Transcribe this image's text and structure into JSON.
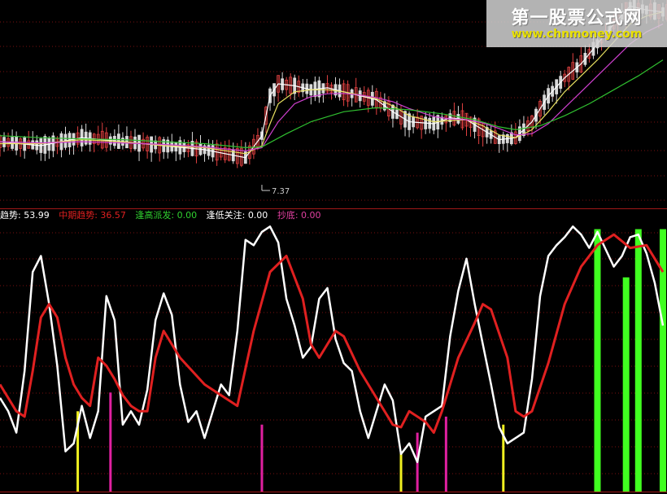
{
  "colors": {
    "background": "#000000",
    "grid": "#7a1010",
    "divider": "#a01818",
    "candle_up": "#e04040",
    "candle_down": "#d8d8d8",
    "ma_white": "#ffffff",
    "ma_yellow": "#e8e060",
    "ma_magenta": "#d040d0",
    "ma_green": "#30c030",
    "short_trend": "#ffffff",
    "mid_trend": "#e02020",
    "signal_yellow": "#f0f020",
    "signal_magenta": "#e020a0",
    "signal_green": "#40ff20"
  },
  "price_panel": {
    "low_marker_label": "7.37"
  },
  "indicator_bar": [
    {
      "label": "趋势",
      "value": "53.99",
      "color": "#ffffff"
    },
    {
      "label": "中期趋势",
      "value": "36.57",
      "color": "#e02020"
    },
    {
      "label": "逢高派发",
      "value": "0.00",
      "color": "#30d030"
    },
    {
      "label": "逢低关注",
      "value": "0.00",
      "color": "#ffffff"
    },
    {
      "label": "抄底",
      "value": "0.00",
      "color": "#e040a0"
    }
  ],
  "watermark": {
    "title": "第一股票公式网",
    "url": "www.chnmoney.com"
  },
  "chart_data": [
    {
      "type": "line",
      "panel": "price",
      "x_range": [
        0,
        163
      ],
      "y_range": [
        6.8,
        12.0
      ],
      "series": [
        {
          "color": "#ffffff",
          "x": [
            0,
            10,
            20,
            30,
            40,
            50,
            60,
            64,
            66,
            68,
            72,
            76,
            80,
            84,
            88,
            92,
            96,
            100,
            106,
            110,
            114,
            118,
            122,
            126,
            130,
            134,
            138,
            142,
            146,
            150,
            154,
            158,
            162
          ],
          "y": [
            8.45,
            8.35,
            8.55,
            8.45,
            8.35,
            8.25,
            8.05,
            8.6,
            9.6,
            9.9,
            9.85,
            9.75,
            9.8,
            9.7,
            9.6,
            9.5,
            9.2,
            8.95,
            8.9,
            9.05,
            9.0,
            8.75,
            8.5,
            8.55,
            8.95,
            9.6,
            10.05,
            10.4,
            10.9,
            11.4,
            11.85,
            11.75,
            11.7
          ]
        },
        {
          "color": "#e8e060",
          "x": [
            0,
            10,
            20,
            30,
            40,
            50,
            60,
            64,
            66,
            68,
            72,
            76,
            80,
            84,
            88,
            92,
            96,
            100,
            106,
            110,
            114,
            118,
            122,
            126,
            130,
            134,
            138,
            142,
            146,
            150,
            154,
            158,
            162
          ],
          "y": [
            8.4,
            8.4,
            8.5,
            8.45,
            8.35,
            8.3,
            8.15,
            8.35,
            8.9,
            9.4,
            9.7,
            9.75,
            9.75,
            9.7,
            9.62,
            9.52,
            9.35,
            9.1,
            8.95,
            8.98,
            9.0,
            8.85,
            8.62,
            8.55,
            8.75,
            9.2,
            9.7,
            10.1,
            10.5,
            10.95,
            11.4,
            11.6,
            11.7
          ]
        },
        {
          "color": "#d040d0",
          "x": [
            0,
            10,
            20,
            30,
            40,
            50,
            60,
            64,
            68,
            72,
            76,
            80,
            84,
            88,
            92,
            96,
            100,
            106,
            110,
            114,
            118,
            122,
            126,
            130,
            134,
            138,
            142,
            146,
            150,
            154,
            158,
            162
          ],
          "y": [
            8.45,
            8.42,
            8.45,
            8.42,
            8.38,
            8.32,
            8.22,
            8.3,
            8.95,
            9.4,
            9.58,
            9.65,
            9.66,
            9.62,
            9.55,
            9.45,
            9.28,
            9.08,
            9.02,
            9.0,
            8.92,
            8.78,
            8.62,
            8.65,
            8.9,
            9.3,
            9.7,
            10.1,
            10.5,
            10.9,
            11.2,
            11.4
          ]
        },
        {
          "color": "#30c030",
          "x": [
            0,
            10,
            20,
            30,
            40,
            50,
            60,
            64,
            70,
            76,
            84,
            92,
            100,
            108,
            116,
            122,
            126,
            132,
            138,
            144,
            150,
            156,
            162
          ],
          "y": [
            8.6,
            8.55,
            8.52,
            8.5,
            8.45,
            8.4,
            8.3,
            8.32,
            8.65,
            8.95,
            9.2,
            9.3,
            9.25,
            9.15,
            9.0,
            8.82,
            8.75,
            8.85,
            9.1,
            9.4,
            9.75,
            10.1,
            10.5
          ]
        }
      ],
      "low_marker": {
        "x": 64,
        "y": 7.37
      }
    },
    {
      "type": "line",
      "panel": "indicator",
      "x_range": [
        0,
        163
      ],
      "y_range": [
        0,
        100
      ],
      "series": [
        {
          "name": "趋势",
          "color": "#ffffff",
          "x": [
            0,
            2,
            4,
            6,
            8,
            10,
            12,
            14,
            16,
            18,
            20,
            22,
            24,
            26,
            28,
            30,
            32,
            34,
            36,
            38,
            40,
            42,
            44,
            46,
            48,
            50,
            52,
            54,
            56,
            58,
            60,
            62,
            64,
            66,
            68,
            70,
            72,
            74,
            76,
            78,
            80,
            82,
            84,
            86,
            88,
            90,
            92,
            94,
            96,
            98,
            100,
            102,
            104,
            106,
            108,
            110,
            112,
            114,
            116,
            118,
            120,
            122,
            124,
            126,
            128,
            130,
            132,
            134,
            136,
            138,
            140,
            142,
            144,
            146,
            150,
            152,
            154,
            156,
            158,
            160,
            162
          ],
          "y": [
            35,
            30,
            22,
            45,
            82,
            88,
            70,
            47,
            15,
            18,
            32,
            20,
            30,
            73,
            64,
            25,
            30,
            25,
            38,
            64,
            74,
            66,
            40,
            26,
            30,
            20,
            30,
            40,
            36,
            60,
            94,
            92,
            97,
            99,
            93,
            72,
            62,
            50,
            54,
            72,
            76,
            57,
            48,
            45,
            30,
            20,
            30,
            40,
            34,
            14,
            18,
            11,
            28,
            30,
            32,
            58,
            75,
            87,
            70,
            55,
            40,
            24,
            18,
            20,
            22,
            42,
            73,
            88,
            92,
            95,
            99,
            96,
            91,
            97,
            84,
            88,
            95,
            96,
            89,
            78,
            62
          ]
        },
        {
          "name": "中期趋势",
          "color": "#e02020",
          "x": [
            0,
            4,
            6,
            8,
            10,
            12,
            14,
            16,
            18,
            20,
            22,
            24,
            26,
            28,
            30,
            32,
            34,
            36,
            38,
            40,
            44,
            50,
            54,
            58,
            62,
            66,
            70,
            74,
            76,
            78,
            80,
            82,
            84,
            88,
            92,
            96,
            98,
            100,
            104,
            106,
            108,
            112,
            116,
            118,
            120,
            124,
            126,
            128,
            130,
            134,
            138,
            142,
            146,
            150,
            154,
            158,
            162
          ],
          "y": [
            40,
            30,
            28,
            45,
            65,
            70,
            65,
            50,
            40,
            35,
            32,
            50,
            47,
            42,
            36,
            32,
            30,
            30,
            50,
            60,
            50,
            40,
            36,
            32,
            60,
            82,
            88,
            72,
            55,
            50,
            55,
            60,
            58,
            45,
            35,
            25,
            24,
            30,
            26,
            22,
            30,
            50,
            63,
            70,
            68,
            50,
            30,
            28,
            30,
            48,
            70,
            84,
            92,
            96,
            91,
            92,
            82
          ]
        }
      ],
      "signal_bars": [
        {
          "color": "#f0f020",
          "x": [
            19,
            98,
            123
          ],
          "height": [
            30,
            15,
            25
          ]
        },
        {
          "color": "#e020a0",
          "x": [
            27,
            64,
            102,
            109
          ],
          "height": [
            37,
            25,
            22,
            28
          ]
        },
        {
          "color": "#40ff20",
          "x": [
            146,
            153,
            156,
            162
          ],
          "height": [
            98,
            80,
            98,
            98
          ]
        }
      ]
    }
  ]
}
